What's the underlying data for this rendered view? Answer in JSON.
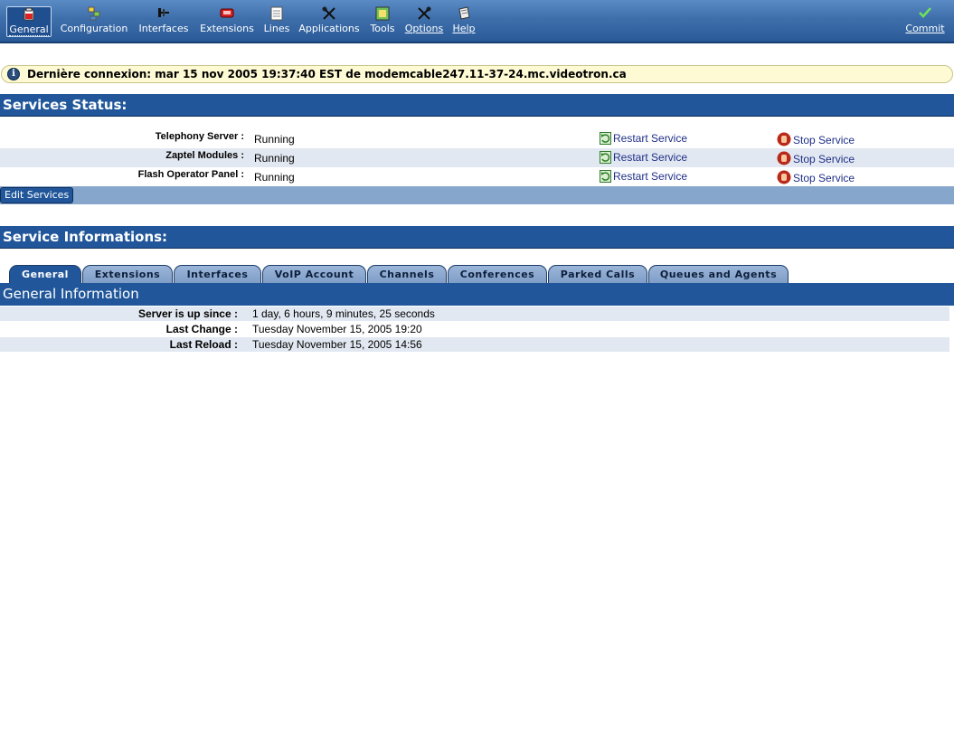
{
  "toolbar": {
    "items": [
      {
        "label": "General",
        "icon": "general-icon"
      },
      {
        "label": "Configuration",
        "icon": "configuration-icon"
      },
      {
        "label": "Interfaces",
        "icon": "interfaces-icon"
      },
      {
        "label": "Extensions",
        "icon": "extensions-icon"
      },
      {
        "label": "Lines",
        "icon": "lines-icon"
      },
      {
        "label": "Applications",
        "icon": "applications-icon"
      },
      {
        "label": "Tools",
        "icon": "tools-icon"
      },
      {
        "label": "Options",
        "icon": "options-icon"
      },
      {
        "label": "Help",
        "icon": "help-icon"
      }
    ],
    "commit_label": "Commit"
  },
  "info": {
    "last_login": "Dernière connexion: mar 15 nov 2005 19:37:40 EST de modemcable247.11-37-24.mc.videotron.ca"
  },
  "services_status": {
    "title": "Services Status:",
    "rows": [
      {
        "name": "Telephony Server :",
        "status": "Running",
        "restart": "Restart Service",
        "stop": "Stop Service"
      },
      {
        "name": "Zaptel Modules :",
        "status": "Running",
        "restart": "Restart Service",
        "stop": "Stop Service"
      },
      {
        "name": "Flash Operator Panel :",
        "status": "Running",
        "restart": "Restart Service",
        "stop": "Stop Service"
      }
    ],
    "edit_label": "Edit Services"
  },
  "service_info": {
    "title": "Service Informations:",
    "tabs": [
      "General",
      "Extensions",
      "Interfaces",
      "VoIP Account",
      "Channels",
      "Conferences",
      "Parked Calls",
      "Queues and Agents"
    ],
    "active_tab": "General",
    "panel_title": "General Information",
    "rows": [
      {
        "label": "Server is up since :",
        "value": "1 day, 6 hours, 9 minutes, 25 seconds"
      },
      {
        "label": "Last Change :",
        "value": "Tuesday November 15, 2005 19:20"
      },
      {
        "label": "Last Reload :",
        "value": "Tuesday November 15, 2005 14:56"
      }
    ]
  },
  "colors": {
    "header_blue": "#21579a",
    "row_alt": "#e2e8f1",
    "info_yellow": "#fefad3",
    "link_blue": "#1f2f87"
  }
}
